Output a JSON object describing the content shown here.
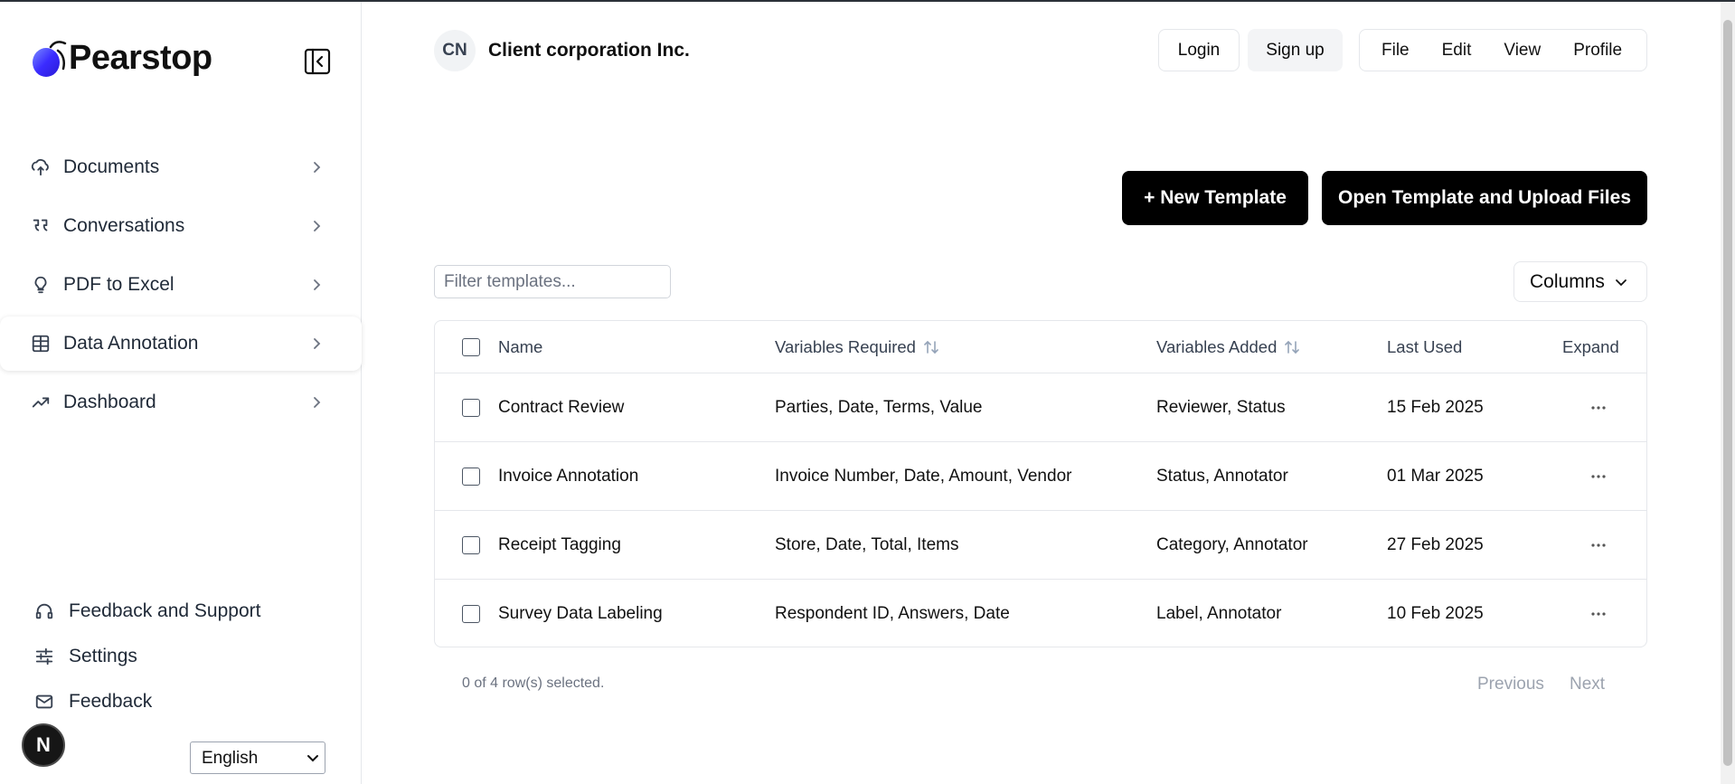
{
  "brand": {
    "name": "Pearstop"
  },
  "sidebar": {
    "items": [
      {
        "label": "Documents",
        "icon": "cloud-upload-icon"
      },
      {
        "label": "Conversations",
        "icon": "quote-icon"
      },
      {
        "label": "PDF to Excel",
        "icon": "lightbulb-icon"
      },
      {
        "label": "Data Annotation",
        "icon": "table-grid-icon",
        "active": true
      },
      {
        "label": "Dashboard",
        "icon": "trending-up-icon"
      }
    ],
    "bottom": [
      {
        "label": "Feedback and Support",
        "icon": "headphones-icon"
      },
      {
        "label": "Settings",
        "icon": "sliders-icon"
      },
      {
        "label": "Feedback",
        "icon": "mail-icon"
      }
    ],
    "badge": "N",
    "language": "English"
  },
  "header": {
    "avatar_initials": "CN",
    "org_name": "Client corporation Inc.",
    "login": "Login",
    "signup": "Sign up",
    "menu": [
      "File",
      "Edit",
      "View",
      "Profile"
    ]
  },
  "actions": {
    "new_template": "+ New Template",
    "open_template": "Open Template and Upload Files"
  },
  "filter": {
    "placeholder": "Filter templates..."
  },
  "columns_button": "Columns",
  "table": {
    "headers": {
      "name": "Name",
      "required": "Variables Required",
      "added": "Variables Added",
      "last_used": "Last Used",
      "expand": "Expand"
    },
    "rows": [
      {
        "name": "Contract Review",
        "required": "Parties, Date, Terms, Value",
        "added": "Reviewer, Status",
        "last_used": "15 Feb 2025"
      },
      {
        "name": "Invoice Annotation",
        "required": "Invoice Number, Date, Amount, Vendor",
        "added": "Status, Annotator",
        "last_used": "01 Mar 2025"
      },
      {
        "name": "Receipt Tagging",
        "required": "Store, Date, Total, Items",
        "added": "Category, Annotator",
        "last_used": "27 Feb 2025"
      },
      {
        "name": "Survey Data Labeling",
        "required": "Respondent ID, Answers, Date",
        "added": "Label, Annotator",
        "last_used": "10 Feb 2025"
      }
    ]
  },
  "footer": {
    "selection": "0 of 4 row(s) selected.",
    "previous": "Previous",
    "next": "Next"
  },
  "colors": {
    "accent": "#000000",
    "logo_gradient_start": "#3b2cff",
    "logo_gradient_end": "#7a8cff"
  }
}
